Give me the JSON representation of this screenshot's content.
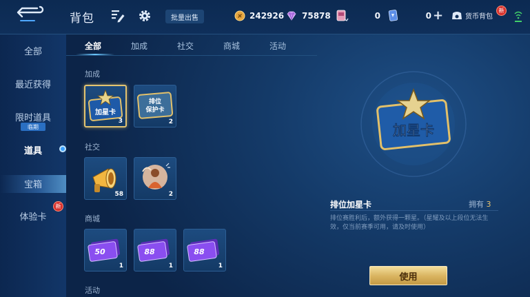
{
  "header": {
    "title": "背包",
    "batch_sell_label": "批量出售",
    "currency_gold": "242926",
    "currency_gem": "75878",
    "currency_ticket": "0",
    "currency_card": "0",
    "currency_bag_label": "货币背包",
    "new_badge": "新"
  },
  "sidebar": {
    "items": [
      {
        "label": "全部"
      },
      {
        "label": "最近获得"
      },
      {
        "label": "限时道具",
        "tag": "临期"
      },
      {
        "label": "道具"
      },
      {
        "label": "宝箱"
      },
      {
        "label": "体验卡",
        "badge": "新"
      }
    ]
  },
  "tabs": [
    {
      "label": "全部"
    },
    {
      "label": "加成"
    },
    {
      "label": "社交"
    },
    {
      "label": "商城"
    },
    {
      "label": "活动"
    }
  ],
  "sections": {
    "boost": "加成",
    "social": "社交",
    "mall": "商城",
    "event": "活动"
  },
  "items": {
    "star_card": {
      "art_text": "加星卡",
      "count": "3"
    },
    "protect_card": {
      "art_text_1": "排位",
      "art_text_2": "保护卡",
      "count": "2"
    },
    "megaphone": {
      "count": "58"
    },
    "gift": {
      "count": "2"
    },
    "voucher_50": {
      "art_text": "50",
      "count": "1"
    },
    "voucher_88a": {
      "art_text": "88",
      "count": "1"
    },
    "voucher_88b": {
      "art_text": "88",
      "count": "1"
    }
  },
  "detail": {
    "art_text": "加星卡",
    "name": "排位加星卡",
    "owned_label": "拥有",
    "owned_count": "3",
    "description": "排位赛胜利后，额外获得一颗星。（星耀及以上段位无法生效，仅当前赛季可用，请及时使用）",
    "use_label": "使用"
  },
  "colors": {
    "gold_accent": "#e4c470",
    "active_blue": "#6cc8ff",
    "badge_red": "#d8322e"
  }
}
